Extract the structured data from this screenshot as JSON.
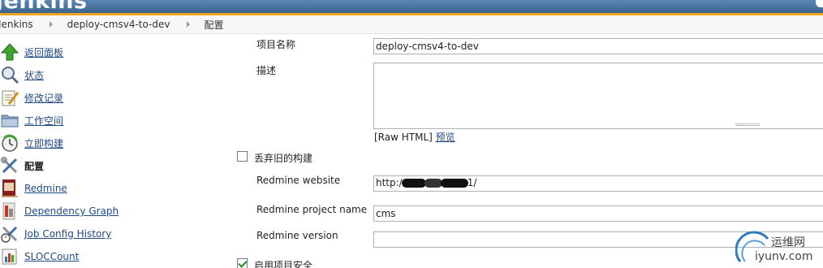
{
  "header": {
    "logo": "Jenkins"
  },
  "breadcrumb": [
    {
      "label": "Jenkins"
    },
    {
      "label": "deploy-cmsv4-to-dev"
    },
    {
      "label": "配置"
    }
  ],
  "sidebar": {
    "items": [
      {
        "label": "返回面板",
        "icon": "up-arrow-icon"
      },
      {
        "label": "状态",
        "icon": "magnifier-icon"
      },
      {
        "label": "修改记录",
        "icon": "notepad-icon"
      },
      {
        "label": "工作空间",
        "icon": "folder-icon"
      },
      {
        "label": "立即构建",
        "icon": "build-clock-icon"
      },
      {
        "label": "配置",
        "icon": "tools-icon",
        "active": true
      },
      {
        "label": "Redmine",
        "icon": "redmine-icon"
      },
      {
        "label": "Dependency Graph",
        "icon": "dependency-graph-icon"
      },
      {
        "label": "Job Config History",
        "icon": "config-history-icon"
      },
      {
        "label": "SLOCCount",
        "icon": "sloccount-icon"
      }
    ]
  },
  "form": {
    "project_name_label": "项目名称",
    "project_name_value": "deploy-cmsv4-to-dev",
    "description_label": "描述",
    "description_value": "",
    "raw_html_text": "[Raw HTML]",
    "preview_link": "预览",
    "discard_old_builds_label": "丢弃旧的构建",
    "discard_old_builds_checked": false,
    "redmine_website_label": "Redmine website",
    "redmine_website_prefix": "http:/",
    "redmine_website_suffix": "1/",
    "redmine_project_label": "Redmine project name",
    "redmine_project_value": "cms",
    "redmine_version_label": "Redmine version",
    "redmine_version_value": "",
    "enable_security_label": "启用项目安全",
    "enable_security_checked": true
  },
  "watermark": {
    "line1": "运维网",
    "line2": "iyunv.com"
  },
  "colors": {
    "header": "#4a74a2",
    "band": "#f0a51f",
    "link": "#204a87",
    "check": "#1a8f1a"
  }
}
